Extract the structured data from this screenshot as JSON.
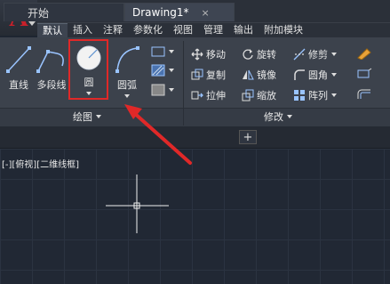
{
  "app": {
    "logo_letter": "A",
    "brand_color": "#c8202a"
  },
  "quick_access": {
    "icons": [
      "new-icon",
      "open-icon",
      "save-icon",
      "save-as-icon",
      "print-icon",
      "undo-icon",
      "redo-icon"
    ]
  },
  "ribbon_tabs": [
    "默认",
    "插入",
    "注释",
    "参数化",
    "视图",
    "管理",
    "输出",
    "附加模块"
  ],
  "ribbon_active_tab": "默认",
  "draw_panel": {
    "title": "绘图",
    "line_label": "直线",
    "polyline_label": "多段线",
    "circle_label": "圆",
    "arc_label": "圆弧"
  },
  "modify_panel": {
    "title": "修改",
    "move": "移动",
    "rotate": "旋转",
    "trim": "修剪",
    "copy": "复制",
    "mirror": "镜像",
    "fillet": "圆角",
    "stretch": "拉伸",
    "scale": "缩放",
    "array": "阵列"
  },
  "doc_tabs": [
    {
      "label": "开始",
      "active": false
    },
    {
      "label": "Drawing1*",
      "active": true,
      "close": "×"
    }
  ],
  "new_tab_symbol": "+",
  "viewport_label": "[-][俯视][二维线框]",
  "highlight_color": "#e02828"
}
